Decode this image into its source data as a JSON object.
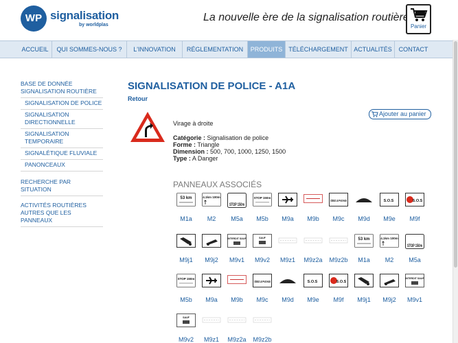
{
  "header": {
    "logo_mark": "WP",
    "logo_name": "signalisation",
    "logo_by": "by worldplas",
    "tagline": "La nouvelle ère de la signalisation routière",
    "cart_label": "Panier"
  },
  "nav": [
    {
      "label": "Accueil",
      "active": false
    },
    {
      "label": "Qui sommes-nous ?",
      "active": false
    },
    {
      "label": "L'innovation",
      "active": false
    },
    {
      "label": "Réglementation",
      "active": false
    },
    {
      "label": "Produits",
      "active": true
    },
    {
      "label": "Téléchargement",
      "active": false
    },
    {
      "label": "Actualités",
      "active": false
    },
    {
      "label": "Contact",
      "active": false
    }
  ],
  "sidebar": [
    {
      "label": "Base de donnée signalisation routière",
      "sub": false
    },
    {
      "label": "Signalisation de police",
      "sub": true
    },
    {
      "label": "Signalisation directionnelle",
      "sub": true
    },
    {
      "label": "Signalisation temporaire",
      "sub": true
    },
    {
      "label": "Signalétique fluviale",
      "sub": true
    },
    {
      "label": "Panonceaux",
      "sub": true
    },
    {
      "label": "Recherche par situation",
      "sub": false
    },
    {
      "label": "Activités routières autres que les panneaux",
      "sub": false
    }
  ],
  "product": {
    "title": "Signalisation de police - A1a",
    "back": "Retour",
    "add_to_cart": "Ajouter au panier",
    "description": "Virage à droite",
    "specs": [
      {
        "key": "Catégorie :",
        "value": "Signalisation de police"
      },
      {
        "key": "Forme :",
        "value": "Triangle"
      },
      {
        "key": "Dimension :",
        "value": "500, 700, 1000, 1250, 1500"
      },
      {
        "key": "Type :",
        "value": "A Danger"
      }
    ],
    "sign_colors": {
      "border": "#d92a1c",
      "fill": "#ffffff",
      "symbol": "#111111"
    }
  },
  "associated": {
    "title": "Panneaux associés",
    "items": [
      {
        "code": "M1a",
        "icon": "distance-panel-icon",
        "text": "53 km"
      },
      {
        "code": "M2",
        "icon": "distance-arrows-icon",
        "text": "4.1km 100m"
      },
      {
        "code": "M5a",
        "icon": "stop-distance-icon",
        "text": "STOP 150m"
      },
      {
        "code": "M5b",
        "icon": "stop-small-icon",
        "text": "STOP 150m"
      },
      {
        "code": "M9a",
        "icon": "airplane-icon",
        "text": ""
      },
      {
        "code": "M9b",
        "icon": "railway-icon",
        "text": ""
      },
      {
        "code": "M9c",
        "icon": "cedez-passage-icon",
        "text": "CÉDEZ LE PASSAGE"
      },
      {
        "code": "M9d",
        "icon": "bump-icon",
        "text": ""
      },
      {
        "code": "M9e",
        "icon": "sos-icon",
        "text": "S.O.S"
      },
      {
        "code": "M9f",
        "icon": "sos-red-icon",
        "text": "S.O.S"
      },
      {
        "code": "M9j1",
        "icon": "tow-vehicle-icon",
        "text": ""
      },
      {
        "code": "M9j2",
        "icon": "tow-truck-icon",
        "text": ""
      },
      {
        "code": "M9v1",
        "icon": "interdit-sauf-icon",
        "text": "INTERDIT SAUF"
      },
      {
        "code": "M9v2",
        "icon": "sauf-icon",
        "text": "SAUF"
      },
      {
        "code": "M9z1",
        "icon": "text-panel-icon",
        "text": ""
      },
      {
        "code": "M9z2a",
        "icon": "text-panel-icon",
        "text": ""
      },
      {
        "code": "M9z2b",
        "icon": "text-panel-icon",
        "text": ""
      },
      {
        "code": "M1a",
        "icon": "distance-panel-icon",
        "text": "53 km"
      },
      {
        "code": "M2",
        "icon": "distance-arrows-icon",
        "text": "4.1km 100m"
      },
      {
        "code": "M5a",
        "icon": "stop-distance-icon",
        "text": "STOP 150m"
      },
      {
        "code": "M5b",
        "icon": "stop-small-icon",
        "text": "STOP 150m"
      },
      {
        "code": "M9a",
        "icon": "airplane-icon",
        "text": ""
      },
      {
        "code": "M9b",
        "icon": "railway-icon",
        "text": ""
      },
      {
        "code": "M9c",
        "icon": "cedez-passage-icon",
        "text": "CÉDEZ LE PASSAGE"
      },
      {
        "code": "M9d",
        "icon": "bump-icon",
        "text": ""
      },
      {
        "code": "M9e",
        "icon": "sos-icon",
        "text": "S.O.S"
      },
      {
        "code": "M9f",
        "icon": "sos-red-icon",
        "text": "S.O.S"
      },
      {
        "code": "M9j1",
        "icon": "tow-vehicle-icon",
        "text": ""
      },
      {
        "code": "M9j2",
        "icon": "tow-truck-icon",
        "text": ""
      },
      {
        "code": "M9v1",
        "icon": "interdit-sauf-icon",
        "text": "INTERDIT SAUF"
      },
      {
        "code": "M9v2",
        "icon": "sauf-icon",
        "text": "SAUF"
      },
      {
        "code": "M9z1",
        "icon": "text-panel-icon",
        "text": ""
      },
      {
        "code": "M9z2a",
        "icon": "text-panel-icon",
        "text": ""
      },
      {
        "code": "M9z2b",
        "icon": "text-panel-icon",
        "text": ""
      }
    ]
  },
  "colors": {
    "brand": "#1f5fa0",
    "nav_bg": "#dfe9f3",
    "nav_active": "#8fb4d8",
    "muted": "#7a7a7a"
  }
}
